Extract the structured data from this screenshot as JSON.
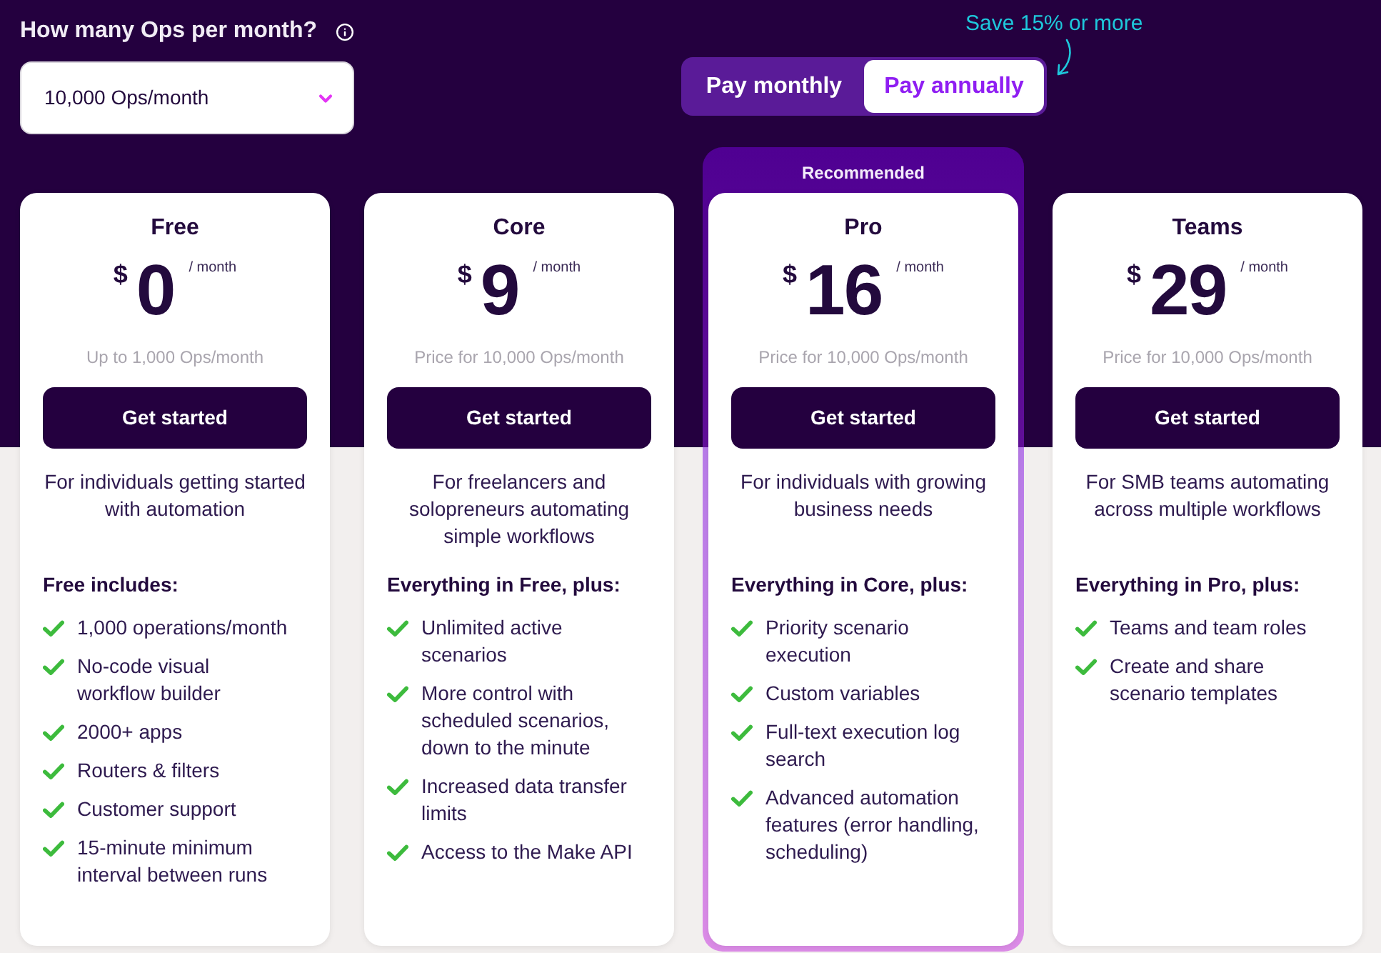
{
  "ops_question": {
    "label": "How many Ops per month?"
  },
  "ops_select": {
    "value": "10,000 Ops/month"
  },
  "billing_toggle": {
    "options": [
      {
        "label": "Pay monthly",
        "selected": false
      },
      {
        "label": "Pay annually",
        "selected": true
      }
    ],
    "note": "Save 15% or more"
  },
  "plans": [
    {
      "name": "Free",
      "currency": "$",
      "price": "0",
      "period": "/ month",
      "ops_note": "Up to 1,000 Ops/month",
      "button": "Get started",
      "description": "For individuals getting started with automation",
      "features_heading": "Free includes:",
      "features": [
        "1,000 operations/month",
        "No-code visual workflow builder",
        "2000+ apps",
        "Routers & filters",
        "Customer support",
        "15-minute minimum interval between runs"
      ]
    },
    {
      "name": "Core",
      "currency": "$",
      "price": "9",
      "period": "/ month",
      "ops_note": "Price for 10,000 Ops/month",
      "button": "Get started",
      "description": "For freelancers and solopreneurs automating simple workflows",
      "features_heading": "Everything in Free, plus:",
      "features": [
        "Unlimited active scenarios",
        "More control with scheduled scenarios, down to the minute",
        "Increased data transfer limits",
        "Access to the Make API"
      ]
    },
    {
      "name": "Pro",
      "badge": "Recommended",
      "currency": "$",
      "price": "16",
      "period": "/ month",
      "ops_note": "Price for 10,000 Ops/month",
      "button": "Get started",
      "description": "For individuals with growing business needs",
      "features_heading": "Everything in Core, plus:",
      "features": [
        "Priority scenario execution",
        "Custom variables",
        "Full-text execution log search",
        "Advanced automation features (error handling, scheduling)"
      ]
    },
    {
      "name": "Teams",
      "currency": "$",
      "price": "29",
      "period": "/ month",
      "ops_note": "Price for 10,000 Ops/month",
      "button": "Get started",
      "description": "For SMB teams automating across multiple workflows",
      "features_heading": "Everything in Pro, plus:",
      "features": [
        "Teams and team roles",
        "Create and share scenario templates"
      ]
    }
  ]
}
